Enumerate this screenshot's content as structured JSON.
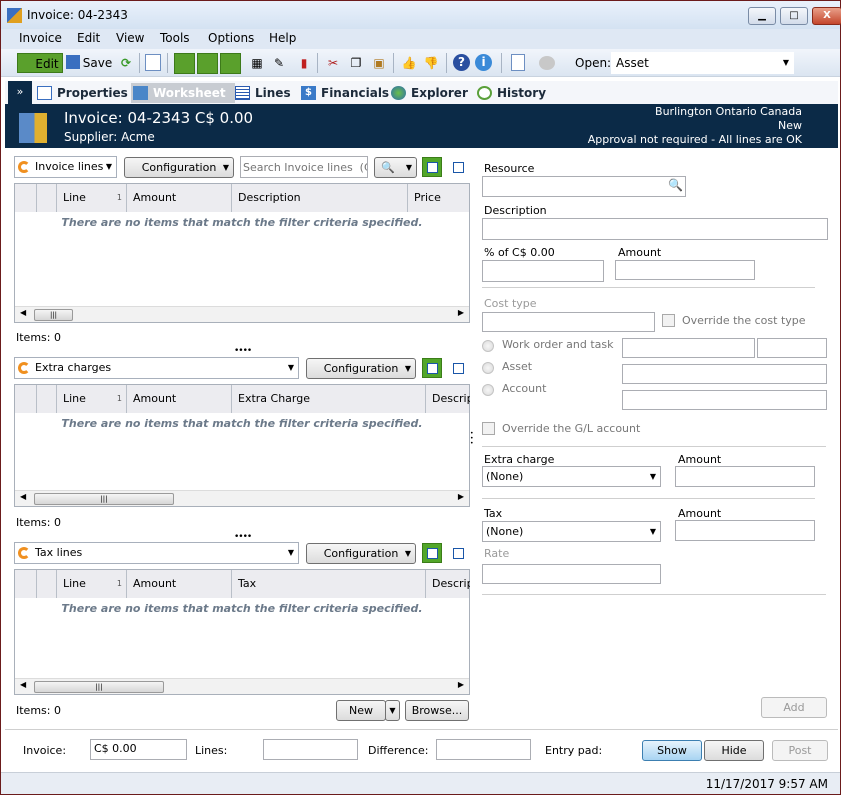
{
  "window": {
    "title": "Invoice: 04-2343",
    "minimize": "▁",
    "maximize": "□",
    "close": "X"
  },
  "menu": [
    "Invoice",
    "Edit",
    "View",
    "Tools",
    "Options",
    "Help"
  ],
  "toolbar": {
    "edit": "Edit",
    "save": "Save",
    "open_label": "Open:",
    "open_value": "Asset"
  },
  "tabs": [
    "Properties",
    "Worksheet",
    "Lines",
    "Financials",
    "Explorer",
    "History"
  ],
  "active_tab": "Worksheet",
  "header": {
    "title": "Invoice: 04-2343  C$ 0.00",
    "supplier": "Supplier: Acme",
    "location": "Burlington Ontario Canada",
    "status": "New",
    "approval": "Approval not required - All lines are OK",
    "bg": "#0b2a47"
  },
  "grids": [
    {
      "selector": "Invoice lines",
      "config": "Configuration",
      "search_placeholder": "Search Invoice lines  (Ctrl+",
      "columns": [
        "Line",
        "Amount",
        "Description",
        "Price"
      ],
      "sort": "1",
      "empty": "There are no items that match the filter criteria specified.",
      "items": "Items: 0"
    },
    {
      "selector": "Extra charges",
      "config": "Configuration",
      "columns": [
        "Line",
        "Amount",
        "Extra Charge",
        "Descrip"
      ],
      "sort": "1",
      "empty": "There are no items that match the filter criteria specified.",
      "items": "Items: 0"
    },
    {
      "selector": "Tax lines",
      "config": "Configuration",
      "columns": [
        "Line",
        "Amount",
        "Tax",
        "Descrip"
      ],
      "sort": "1",
      "empty": "There are no items that match the filter criteria specified.",
      "items": "Items: 0"
    }
  ],
  "grid_buttons": {
    "new": "New",
    "browse": "Browse..."
  },
  "form": {
    "resource": "Resource",
    "description": "Description",
    "percent_of": "% of  C$ 0.00",
    "amount": "Amount",
    "cost_type": "Cost type",
    "override_cost_type": "Override the cost type",
    "work_order": "Work order and task",
    "asset": "Asset",
    "account": "Account",
    "override_gl": "Override the G/L account",
    "extra_charge": "Extra charge",
    "extra_charge_value": "(None)",
    "extra_amount": "Amount",
    "tax": "Tax",
    "tax_value": "(None)",
    "tax_amount": "Amount",
    "rate": "Rate",
    "add": "Add"
  },
  "footer": {
    "invoice_label": "Invoice:",
    "invoice_value": "C$ 0.00",
    "lines_label": "Lines:",
    "lines_value": "",
    "difference_label": "Difference:",
    "difference_value": "",
    "entry_pad": "Entry pad:",
    "show": "Show",
    "hide": "Hide",
    "post": "Post"
  },
  "status": {
    "datetime": "11/17/2017 9:57 AM"
  }
}
